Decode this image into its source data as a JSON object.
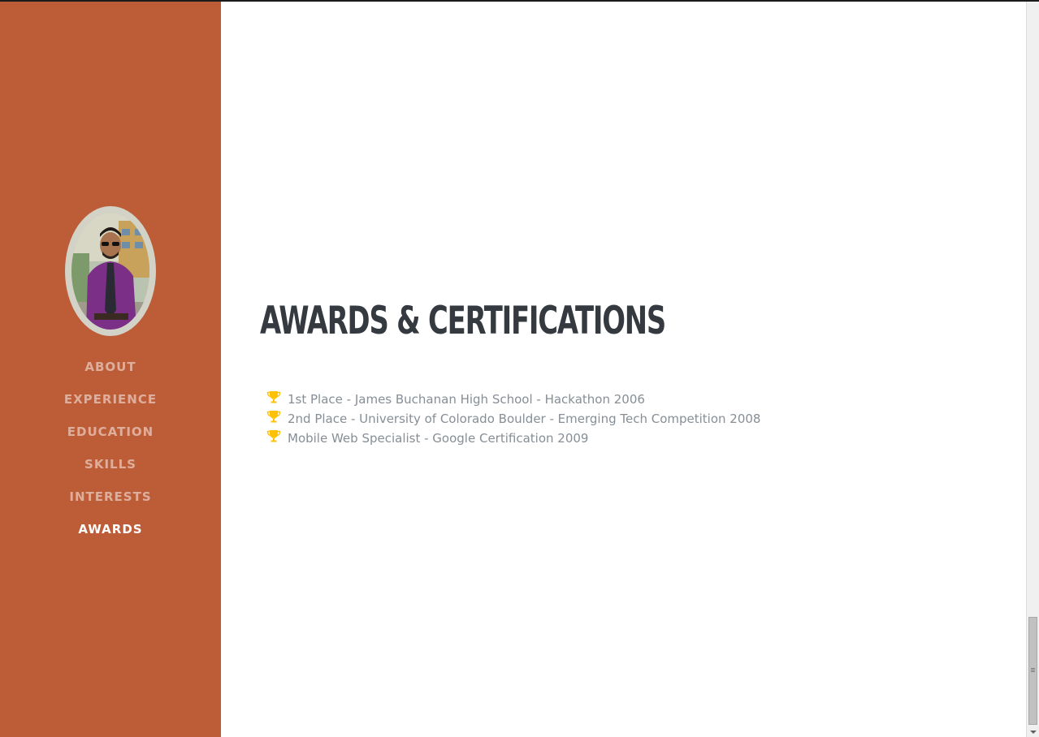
{
  "sidebar": {
    "nav": [
      {
        "label": "ABOUT",
        "active": false
      },
      {
        "label": "EXPERIENCE",
        "active": false
      },
      {
        "label": "EDUCATION",
        "active": false
      },
      {
        "label": "SKILLS",
        "active": false
      },
      {
        "label": "INTERESTS",
        "active": false
      },
      {
        "label": "AWARDS",
        "active": true
      }
    ],
    "background_color": "#bd5d38"
  },
  "main": {
    "section_title": "AWARDS & CERTIFICATIONS",
    "awards": [
      {
        "icon": "trophy-icon",
        "text": "1st Place - James Buchanan High School - Hackathon 2006"
      },
      {
        "icon": "trophy-icon",
        "text": "2nd Place - University of Colorado Boulder - Emerging Tech Competition 2008"
      },
      {
        "icon": "trophy-icon",
        "text": "Mobile Web Specialist - Google Certification 2009"
      }
    ],
    "title_color": "#343a40",
    "text_color": "#868e96",
    "trophy_color": "#ffc107"
  }
}
